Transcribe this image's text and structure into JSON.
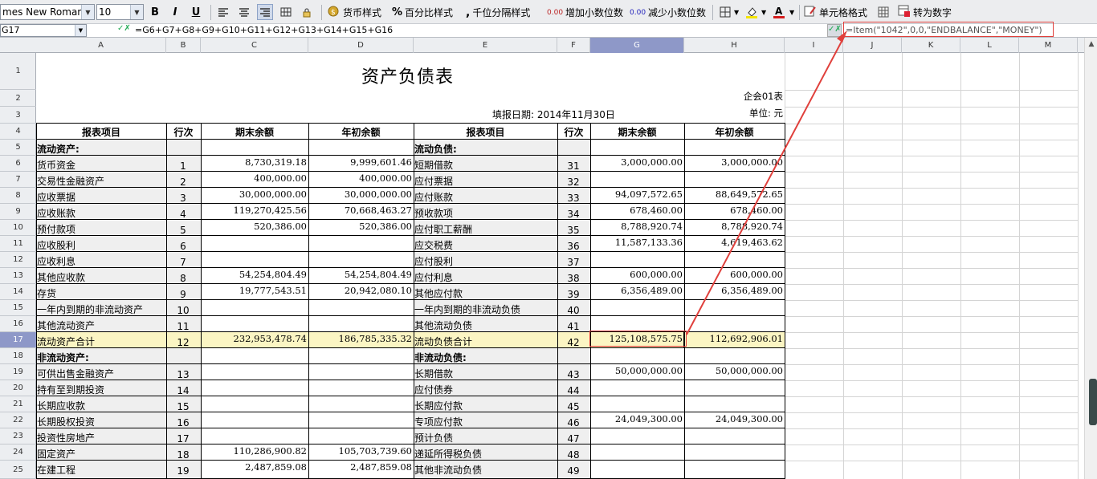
{
  "toolbar": {
    "font_name": "mes New Roman",
    "font_size": "10",
    "bold": "B",
    "italic": "I",
    "underline": "U",
    "currency_style": "货币样式",
    "percent_style": "百分比样式",
    "thousands_style": "千位分隔样式",
    "increase_decimal": "增加小数位数",
    "decrease_decimal": "减少小数位数",
    "cell_format": "单元格格式",
    "to_number": "转为数字",
    "inc_dec_glyph": "0.00",
    "percent_glyph": "%"
  },
  "formula_bar": {
    "cell_ref": "G17",
    "formula": "=G6+G7+G8+G9+G10+G11+G12+G13+G14+G15+G16",
    "item_formula": "=Item(\"1042\",0,0,\"ENDBALANCE\",\"MONEY\")"
  },
  "columns": [
    "A",
    "B",
    "C",
    "D",
    "E",
    "F",
    "G",
    "H",
    "I",
    "J",
    "K",
    "L",
    "M"
  ],
  "rows": [
    "1",
    "2",
    "3",
    "4",
    "5",
    "6",
    "7",
    "8",
    "9",
    "10",
    "11",
    "12",
    "13",
    "14",
    "15",
    "16",
    "17",
    "18",
    "19",
    "20",
    "21",
    "22",
    "23",
    "24",
    "25"
  ],
  "sheet": {
    "title": "资产负债表",
    "company_code": "企会01表",
    "report_date": "填报日期: 2014年11月30日",
    "unit": "单位: 元",
    "headers": {
      "item": "报表项目",
      "seq": "行次",
      "end": "期末余额",
      "begin": "年初余额",
      "item2": "报表项目",
      "seq2": "行次",
      "end2": "期末余额",
      "begin2": "年初余额"
    },
    "body": [
      [
        "流动资产:",
        "",
        "",
        "",
        "流动负债:",
        "",
        "",
        ""
      ],
      [
        "货币资金",
        "1",
        "8,730,319.18",
        "9,999,601.46",
        "短期借款",
        "31",
        "3,000,000.00",
        "3,000,000.00"
      ],
      [
        "交易性金融资产",
        "2",
        "400,000.00",
        "400,000.00",
        "应付票据",
        "32",
        "",
        ""
      ],
      [
        "应收票据",
        "3",
        "30,000,000.00",
        "30,000,000.00",
        "应付账款",
        "33",
        "94,097,572.65",
        "88,649,572.65"
      ],
      [
        "应收账款",
        "4",
        "119,270,425.56",
        "70,668,463.27",
        "预收款项",
        "34",
        "678,460.00",
        "678,460.00"
      ],
      [
        "预付款项",
        "5",
        "520,386.00",
        "520,386.00",
        "应付职工薪酬",
        "35",
        "8,788,920.74",
        "8,788,920.74"
      ],
      [
        "应收股利",
        "6",
        "",
        "",
        "应交税费",
        "36",
        "11,587,133.36",
        "4,619,463.62"
      ],
      [
        "应收利息",
        "7",
        "",
        "",
        "应付股利",
        "37",
        "",
        ""
      ],
      [
        "其他应收款",
        "8",
        "54,254,804.49",
        "54,254,804.49",
        "应付利息",
        "38",
        "600,000.00",
        "600,000.00"
      ],
      [
        "存货",
        "9",
        "19,777,543.51",
        "20,942,080.10",
        "其他应付款",
        "39",
        "6,356,489.00",
        "6,356,489.00"
      ],
      [
        "一年内到期的非流动资产",
        "10",
        "",
        "",
        "一年内到期的非流动负债",
        "40",
        "",
        ""
      ],
      [
        "其他流动资产",
        "11",
        "",
        "",
        "其他流动负债",
        "41",
        "",
        ""
      ],
      [
        "流动资产合计",
        "12",
        "232,953,478.74",
        "186,785,335.32",
        "流动负债合计",
        "42",
        "125,108,575.75",
        "112,692,906.01"
      ],
      [
        "非流动资产:",
        "",
        "",
        "",
        "非流动负债:",
        "",
        "",
        ""
      ],
      [
        "可供出售金融资产",
        "13",
        "",
        "",
        "长期借款",
        "43",
        "50,000,000.00",
        "50,000,000.00"
      ],
      [
        "持有至到期投资",
        "14",
        "",
        "",
        "应付债券",
        "44",
        "",
        ""
      ],
      [
        "长期应收款",
        "15",
        "",
        "",
        "长期应付款",
        "45",
        "",
        ""
      ],
      [
        "长期股权投资",
        "16",
        "",
        "",
        "专项应付款",
        "46",
        "24,049,300.00",
        "24,049,300.00"
      ],
      [
        "投资性房地产",
        "17",
        "",
        "",
        "预计负债",
        "47",
        "",
        ""
      ],
      [
        "固定资产",
        "18",
        "110,286,900.82",
        "105,703,739.60",
        "递延所得税负债",
        "48",
        "",
        ""
      ],
      [
        "在建工程",
        "19",
        "2,487,859.08",
        "2,487,859.08",
        "其他非流动负债",
        "49",
        "",
        ""
      ]
    ]
  },
  "colors": {
    "selected_header": "#8e98c8",
    "total_row": "#fbf5c3",
    "annotation": "#e0403c",
    "label_bg": "#efefef"
  }
}
